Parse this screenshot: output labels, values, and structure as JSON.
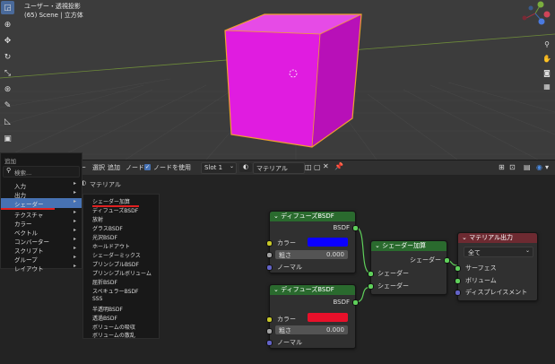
{
  "viewport": {
    "title": "ユーザー・透視投影",
    "subtitle": "(65) Scene | 立方体"
  },
  "header": {
    "menu_items": [
      "選択",
      "追加",
      "ノード"
    ],
    "use_nodes_label": "ノードを使用",
    "slot_value": "Slot 1",
    "material_name": "マテリアル",
    "breadcrumb": "マテリアル"
  },
  "add_menu": {
    "title": "追加",
    "search_placeholder": "検索...",
    "items": [
      {
        "label": "入力"
      },
      {
        "label": "出力"
      },
      {
        "label": "シェーダー"
      },
      {
        "label": "テクスチャ"
      },
      {
        "label": "カラー"
      },
      {
        "label": "ベクトル"
      },
      {
        "label": "コンバーター"
      },
      {
        "label": "スクリプト"
      },
      {
        "label": "グループ"
      },
      {
        "label": "レイアウト"
      }
    ],
    "shader_items": [
      "シェーダー加算",
      "ディフューズBSDF",
      "放射",
      "グラスBSDF",
      "光沢BSDF",
      "ホールドアウト",
      "シェーダーミックス",
      "プリンシプルBSDF",
      "プリンシプルボリューム",
      "屈折BSDF",
      "スペキュラーBSDF",
      "SSS",
      "半透明BSDF",
      "透過BSDF",
      "ボリュームの吸収",
      "ボリュームの散乱"
    ]
  },
  "nodes": {
    "diffuse1": {
      "title": "ディフューズBSDF",
      "output": "BSDF",
      "color_label": "カラー",
      "color_value": "#0b00ff",
      "roughness_label": "粗さ",
      "roughness_value": "0.000",
      "normal_label": "ノーマル"
    },
    "diffuse2": {
      "title": "ディフューズBSDF",
      "output": "BSDF",
      "color_label": "カラー",
      "color_value": "#e8102a",
      "roughness_label": "粗さ",
      "roughness_value": "0.000",
      "normal_label": "ノーマル"
    },
    "add_shader": {
      "title": "シェーダー加算",
      "output": "シェーダー",
      "input1": "シェーダー",
      "input2": "シェーダー"
    },
    "material_output": {
      "title": "マテリアル出力",
      "target": "全て",
      "surface": "サーフェス",
      "volume": "ボリューム",
      "displacement": "ディスプレイスメント"
    }
  },
  "colors": {
    "cube": "#e01ce0",
    "selection_outline": "#f0a030",
    "menu_highlight": "#4772b3"
  }
}
